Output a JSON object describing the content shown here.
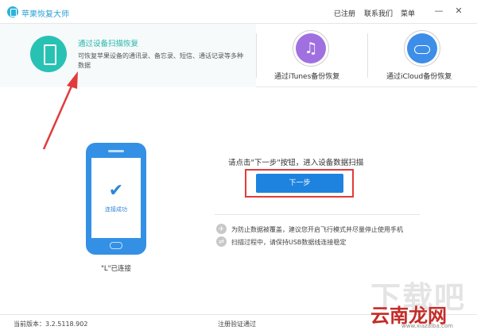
{
  "app": {
    "title": "苹果恢复大师"
  },
  "top_menu": {
    "registered": "已注册",
    "contact": "联系我们",
    "menu": "菜单"
  },
  "window_controls": {
    "minimize": "—",
    "close": "✕"
  },
  "modes": [
    {
      "title": "通过设备扫描恢复",
      "description": "可恢复苹果设备的通讯录、备忘录、短信、通话记录等多种数据",
      "active": true
    },
    {
      "title": "通过iTunes备份恢复",
      "active": false
    },
    {
      "title": "通过iCloud备份恢复",
      "active": false
    }
  ],
  "icons": {
    "phone": "phone-icon",
    "itunes": "music-note-icon",
    "icloud": "cloud-icon",
    "check": "checkmark-icon",
    "airplane": "airplane-icon",
    "usb": "usb-icon"
  },
  "device": {
    "screen_status": "连接成功",
    "connected_label": "\"L\"已连接",
    "check_glyph": "✔"
  },
  "main": {
    "prompt": "请点击\"下一步\"按钮，进入设备数据扫描",
    "next_button": "下一步"
  },
  "tips": [
    {
      "icon": "✈",
      "text": "为防止数据被覆盖，建议您开启飞行模式并尽量停止使用手机"
    },
    {
      "icon": "⇄",
      "text": "扫描过程中，请保持USB数据线连接稳定"
    }
  ],
  "footer": {
    "version": "当前版本：3.2.5118.902",
    "registration": "注册验证通过"
  },
  "watermark": {
    "ghost": "下载吧",
    "brand": "云南龙网",
    "url": "www.xiazaiba.com"
  },
  "colors": {
    "accent_teal": "#28c2b4",
    "primary_blue": "#1e83de",
    "annotation_red": "#e23b3b",
    "itunes_purple": "#a070e0",
    "icloud_blue": "#3d8ee8"
  }
}
